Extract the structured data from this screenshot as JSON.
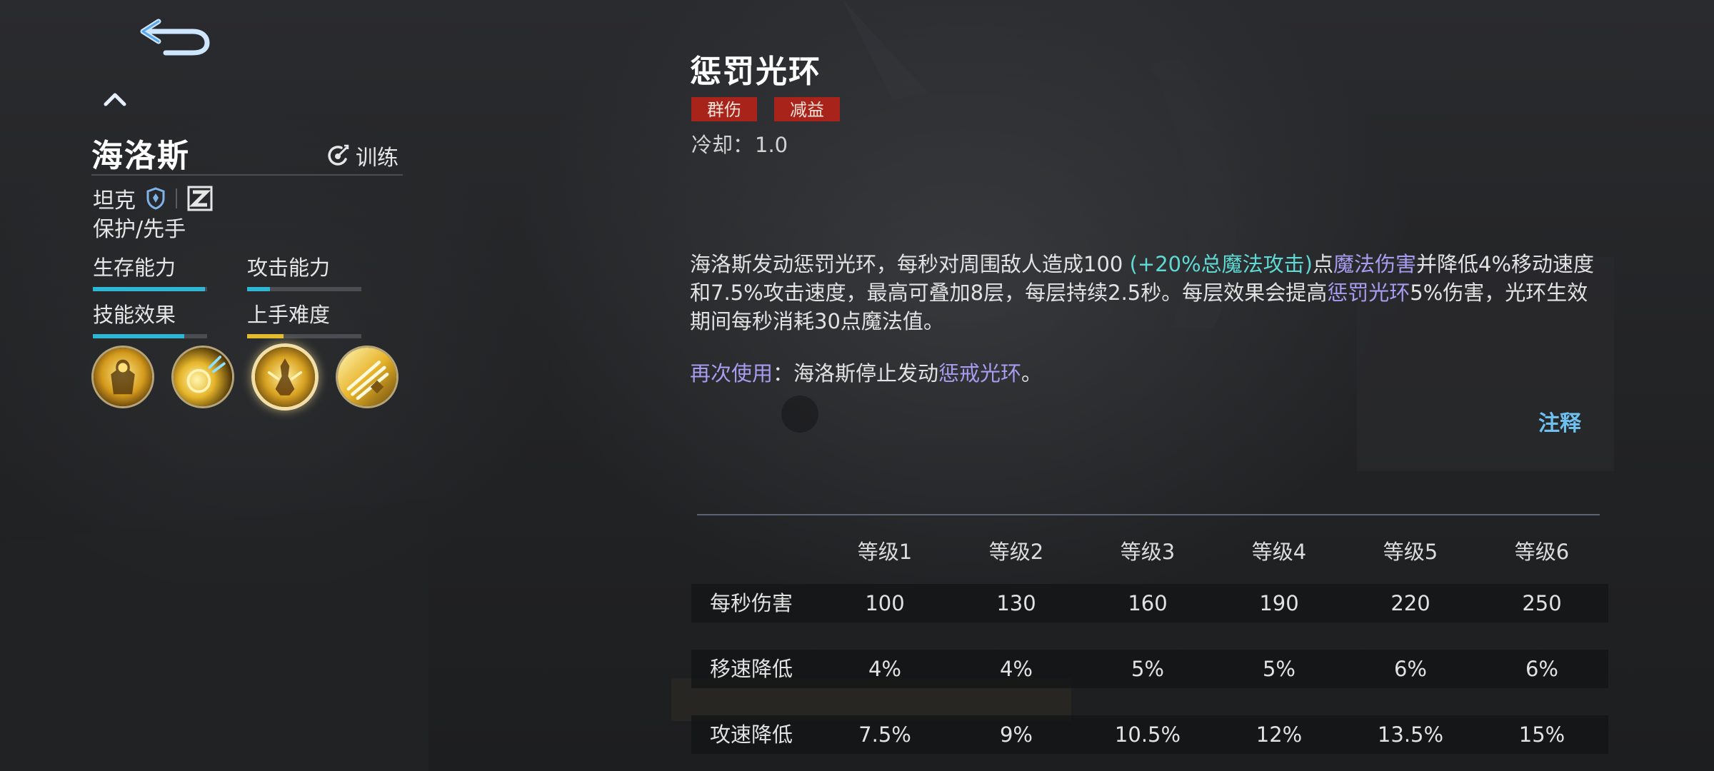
{
  "hero": {
    "name": "海洛斯",
    "train_label": "训练",
    "role": "坦克",
    "positioning": "保护/先手",
    "stats": [
      {
        "label": "生存能力",
        "value": 0.98,
        "color": "#2fb6d4"
      },
      {
        "label": "攻击能力",
        "value": 0.2,
        "color": "#2fb6d4"
      },
      {
        "label": "技能效果",
        "value": 0.8,
        "color": "#2fb6d4"
      },
      {
        "label": "上手难度",
        "value": 0.32,
        "color": "#e2bb2e"
      }
    ],
    "skills": [
      {
        "icon": "hero-passive-icon",
        "selected": false
      },
      {
        "icon": "energy-blast-icon",
        "selected": false
      },
      {
        "icon": "punishment-aura-icon",
        "selected": true
      },
      {
        "icon": "light-rush-icon",
        "selected": false
      }
    ]
  },
  "skill": {
    "title": "惩罚光环",
    "tags": [
      "群伤",
      "减益"
    ],
    "cooldown_label": "冷却：",
    "cooldown_value": "1.0",
    "desc": {
      "part1": "海洛斯发动惩罚光环，每秒对周围敌人造成100 ",
      "scaling": "(+20%总魔法攻击)",
      "part2": "点",
      "damage_type": "魔法伤害",
      "part3": "并降低4%移动速度和7.5%攻击速度，最高可叠加8层，每层持续2.5秒。每层效果会提高",
      "skill_ref": "惩罚光环",
      "part4": "5%伤害，光环生效期间每秒消耗30点魔法值。"
    },
    "recast": {
      "label": "再次使用",
      "text": "：海洛斯停止发动",
      "skill_ref": "惩戒光环",
      "end": "。"
    },
    "note_label": "注释"
  },
  "table": {
    "headers": [
      "等级1",
      "等级2",
      "等级3",
      "等级4",
      "等级5",
      "等级6"
    ],
    "rows": [
      {
        "label": "每秒伤害",
        "values": [
          "100",
          "130",
          "160",
          "190",
          "220",
          "250"
        ]
      },
      {
        "label": "移速降低",
        "values": [
          "4%",
          "4%",
          "5%",
          "5%",
          "6%",
          "6%"
        ]
      },
      {
        "label": "攻速降低",
        "values": [
          "7.5%",
          "9%",
          "10.5%",
          "12%",
          "13.5%",
          "15%"
        ]
      }
    ]
  },
  "colors": {
    "tag_bg": "#a8241a",
    "highlight_cyan": "#5fd9d4",
    "highlight_purple": "#a89cf0",
    "link_blue": "#6ec0ee"
  }
}
